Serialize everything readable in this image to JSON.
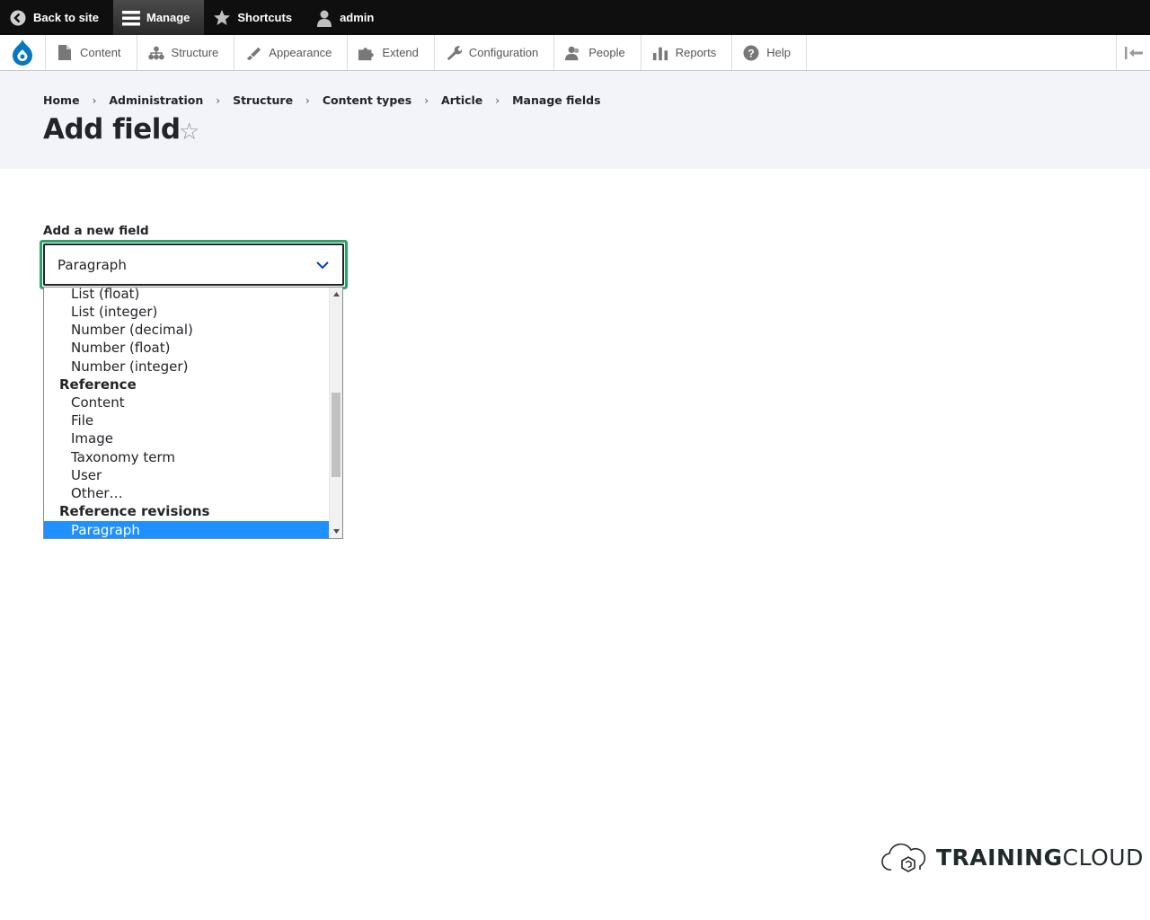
{
  "toolbar": {
    "back_label": "Back to site",
    "manage_label": "Manage",
    "shortcuts_label": "Shortcuts",
    "user_label": "admin"
  },
  "tray": {
    "items": [
      {
        "label": "Content",
        "icon": "file-icon"
      },
      {
        "label": "Structure",
        "icon": "sitemap-icon"
      },
      {
        "label": "Appearance",
        "icon": "paintbrush-icon"
      },
      {
        "label": "Extend",
        "icon": "puzzle-icon"
      },
      {
        "label": "Configuration",
        "icon": "wrench-icon"
      },
      {
        "label": "People",
        "icon": "people-icon"
      },
      {
        "label": "Reports",
        "icon": "bar-chart-icon"
      },
      {
        "label": "Help",
        "icon": "help-icon"
      }
    ]
  },
  "breadcrumb": [
    "Home",
    "Administration",
    "Structure",
    "Content types",
    "Article",
    "Manage fields"
  ],
  "page": {
    "title": "Add field"
  },
  "form": {
    "label": "Add a new field",
    "selected_value": "Paragraph",
    "options": [
      {
        "kind": "option",
        "label": "List (float)"
      },
      {
        "kind": "option",
        "label": "List (integer)"
      },
      {
        "kind": "option",
        "label": "Number (decimal)"
      },
      {
        "kind": "option",
        "label": "Number (float)"
      },
      {
        "kind": "option",
        "label": "Number (integer)"
      },
      {
        "kind": "group",
        "label": "Reference"
      },
      {
        "kind": "option",
        "label": "Content"
      },
      {
        "kind": "option",
        "label": "File"
      },
      {
        "kind": "option",
        "label": "Image"
      },
      {
        "kind": "option",
        "label": "Taxonomy term"
      },
      {
        "kind": "option",
        "label": "User"
      },
      {
        "kind": "option",
        "label": "Other…"
      },
      {
        "kind": "group",
        "label": "Reference revisions"
      },
      {
        "kind": "option",
        "label": "Paragraph",
        "selected": true
      }
    ]
  },
  "brand": {
    "bold": "TRAINING",
    "light": "CLOUD"
  },
  "colors": {
    "focus_ring": "#26a769",
    "selected_option": "#1e90ff",
    "drupal_blue": "#0678be"
  }
}
